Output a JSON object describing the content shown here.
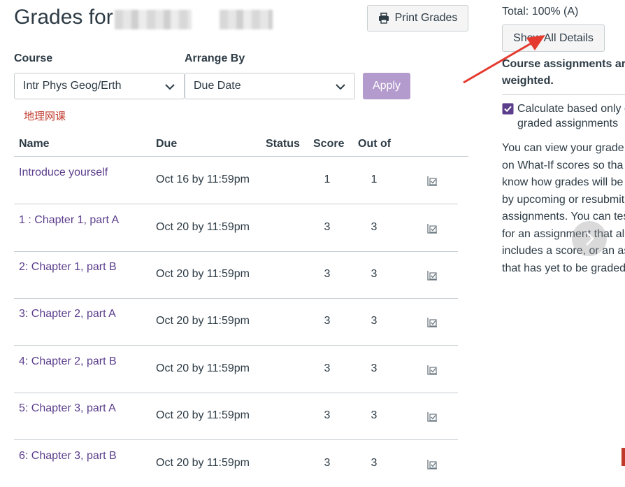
{
  "header": {
    "title": "Grades for",
    "print_label": "Print Grades"
  },
  "filters": {
    "course_label": "Course",
    "course_value": "Intr Phys Geog/Erth",
    "arrange_label": "Arrange By",
    "arrange_value": "Due Date",
    "apply_label": "Apply"
  },
  "annotation": "地理网课",
  "table": {
    "columns": [
      "Name",
      "Due",
      "Status",
      "Score",
      "Out of"
    ],
    "rows": [
      {
        "name": "Introduce yourself",
        "due": "Oct 16 by 11:59pm",
        "score": "1",
        "out_of": "1"
      },
      {
        "name": "1 : Chapter 1, part A",
        "due": "Oct 20 by 11:59pm",
        "score": "3",
        "out_of": "3"
      },
      {
        "name": "2: Chapter 1, part B",
        "due": "Oct 20 by 11:59pm",
        "score": "3",
        "out_of": "3"
      },
      {
        "name": "3: Chapter 2, part A",
        "due": "Oct 20 by 11:59pm",
        "score": "3",
        "out_of": "3"
      },
      {
        "name": "4: Chapter 2, part B",
        "due": "Oct 20 by 11:59pm",
        "score": "3",
        "out_of": "3"
      },
      {
        "name": "5: Chapter 3, part A",
        "due": "Oct 20 by 11:59pm",
        "score": "3",
        "out_of": "3"
      },
      {
        "name": "6: Chapter 3, part B",
        "due": "Oct 20 by 11:59pm",
        "score": "3",
        "out_of": "3"
      }
    ]
  },
  "sidebar": {
    "total": "Total: 100% (A)",
    "show_details_label": "Show All Details",
    "weighted_line1": "Course assignments are",
    "weighted_line2": "weighted.",
    "checkbox_line1": "Calculate based only o",
    "checkbox_line2": "graded assignments",
    "para_lines": [
      "You can view your grade",
      "on What-If scores so tha",
      "know how grades will be",
      "by upcoming or resubmit",
      "assignments. You can tes",
      "for an assignment that al",
      "includes a score, or an as",
      "that has yet to be graded"
    ]
  },
  "colors": {
    "link": "#5b3e8c",
    "apply_bg": "#b49bcd",
    "checkbox": "#5b3e8c",
    "arrow": "#e53a2f",
    "annotation": "#c0392b"
  }
}
